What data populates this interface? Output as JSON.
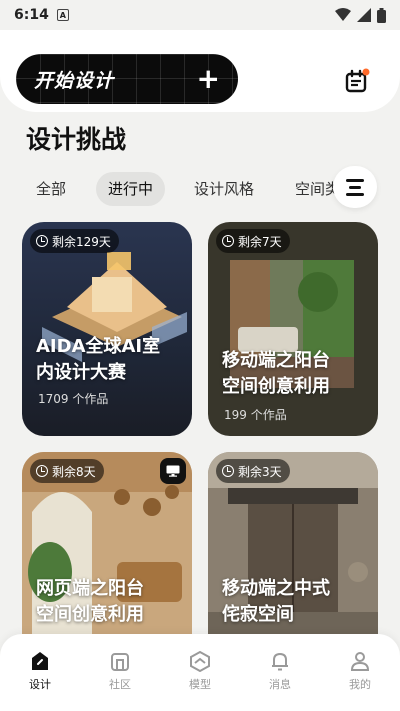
{
  "status_bar": {
    "time": "6:14",
    "app_icon": "A"
  },
  "header": {
    "start_label": "开始设计",
    "plus": "+"
  },
  "section": {
    "title": "设计挑战"
  },
  "tabs": [
    {
      "label": "全部"
    },
    {
      "label": "进行中",
      "active": true
    },
    {
      "label": "设计风格"
    },
    {
      "label": "空间类"
    }
  ],
  "cards": [
    {
      "days": "剩余129天",
      "title_line1": "AIDA全球AI室",
      "title_line2": "内设计大赛",
      "count": "1709 个作品"
    },
    {
      "days": "剩余7天",
      "title_line1": "移动端之阳台",
      "title_line2": "空间创意利用",
      "count": "199 个作品"
    },
    {
      "days": "剩余8天",
      "title_line1": "网页端之阳台",
      "title_line2": "空间创意利用",
      "count": ""
    },
    {
      "days": "剩余3天",
      "title_line1": "移动端之中式",
      "title_line2": "侘寂空间",
      "count": ""
    }
  ],
  "nav": [
    {
      "label": "设计",
      "icon": "design-icon",
      "active": true
    },
    {
      "label": "社区",
      "icon": "community-icon"
    },
    {
      "label": "模型",
      "icon": "model-icon"
    },
    {
      "label": "消息",
      "icon": "bell-icon"
    },
    {
      "label": "我的",
      "icon": "profile-icon"
    }
  ],
  "colors": {
    "background": "#f2f2f0",
    "dark": "#0b0b0b",
    "badge_dot": "#ff6a2a"
  }
}
